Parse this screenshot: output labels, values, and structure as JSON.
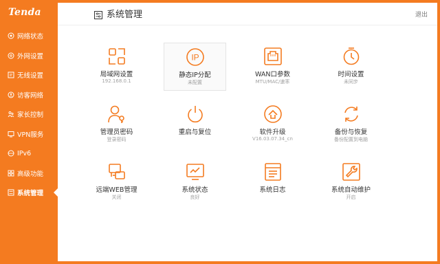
{
  "brand": {
    "logo": "Tenda",
    "accent": "#f47b20"
  },
  "sidebar": {
    "items": [
      {
        "label": "网络状态",
        "icon": "network-status-icon"
      },
      {
        "label": "外网设置",
        "icon": "globe-icon"
      },
      {
        "label": "无线设置",
        "icon": "wifi-settings-icon"
      },
      {
        "label": "访客网络",
        "icon": "guest-icon"
      },
      {
        "label": "家长控制",
        "icon": "parental-icon"
      },
      {
        "label": "VPN服务",
        "icon": "vpn-icon"
      },
      {
        "label": "IPv6",
        "icon": "ipv6-icon"
      },
      {
        "label": "高级功能",
        "icon": "advanced-icon"
      },
      {
        "label": "系统管理",
        "icon": "system-icon",
        "active": true
      }
    ]
  },
  "header": {
    "title": "系统管理",
    "logout": "退出"
  },
  "tiles": [
    {
      "label": "局域网设置",
      "sub": "192.168.0.1",
      "icon": "lan-icon"
    },
    {
      "label": "静态IP分配",
      "sub": "未配置",
      "icon": "static-ip-icon",
      "selected": true
    },
    {
      "label": "WAN口参数",
      "sub": "MTU/MAC/速率",
      "icon": "wan-port-icon"
    },
    {
      "label": "时间设置",
      "sub": "未同步",
      "icon": "clock-icon"
    },
    {
      "label": "管理员密码",
      "sub": "登录密码",
      "icon": "admin-password-icon"
    },
    {
      "label": "重启与复位",
      "sub": "",
      "icon": "power-icon"
    },
    {
      "label": "软件升级",
      "sub": "V16.03.07.34_cn",
      "icon": "upgrade-icon"
    },
    {
      "label": "备份与恢复",
      "sub": "备份配置到电脑",
      "icon": "backup-restore-icon"
    },
    {
      "label": "远端WEB管理",
      "sub": "关闭",
      "icon": "remote-web-icon"
    },
    {
      "label": "系统状态",
      "sub": "良好",
      "icon": "system-status-icon"
    },
    {
      "label": "系统日志",
      "sub": "",
      "icon": "log-icon"
    },
    {
      "label": "系统自动维护",
      "sub": "开启",
      "icon": "maintenance-icon"
    }
  ]
}
